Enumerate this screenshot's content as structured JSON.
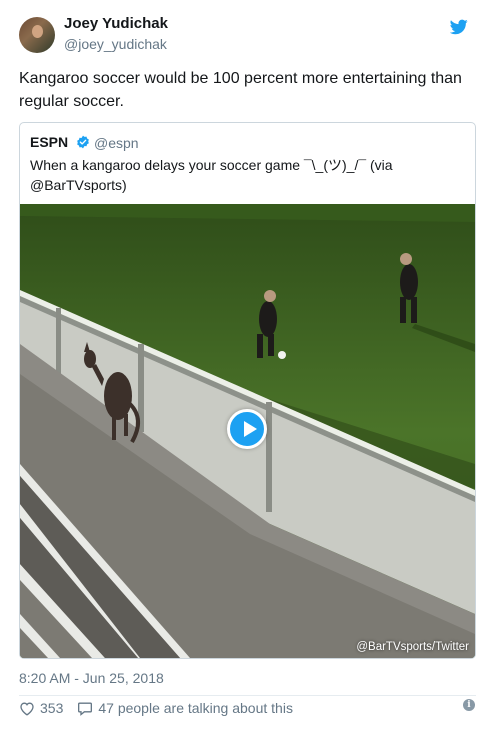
{
  "author": {
    "name": "Joey Yudichak",
    "handle": "@joey_yudichak"
  },
  "tweet_text": "Kangaroo soccer would be 100 percent more entertaining than regular soccer.",
  "quoted": {
    "name": "ESPN",
    "verified": true,
    "handle": "@espn",
    "text": "When a kangaroo delays your soccer game ¯\\_(ツ)_/¯ (via @BarTVsports)",
    "media_credit": "@BarTVsports/Twitter"
  },
  "timestamp": "8:20 AM - Jun 25, 2018",
  "stats": {
    "likes": "353",
    "talking": "47 people are talking about this"
  },
  "icons": {
    "brand": "twitter-bird-icon",
    "like": "heart-icon",
    "reply": "speech-bubble-icon",
    "info": "info-icon",
    "play": "play-icon"
  },
  "colors": {
    "accent": "#1da1f2",
    "muted": "#657786",
    "text": "#14171a",
    "border": "#ccd6dd"
  }
}
